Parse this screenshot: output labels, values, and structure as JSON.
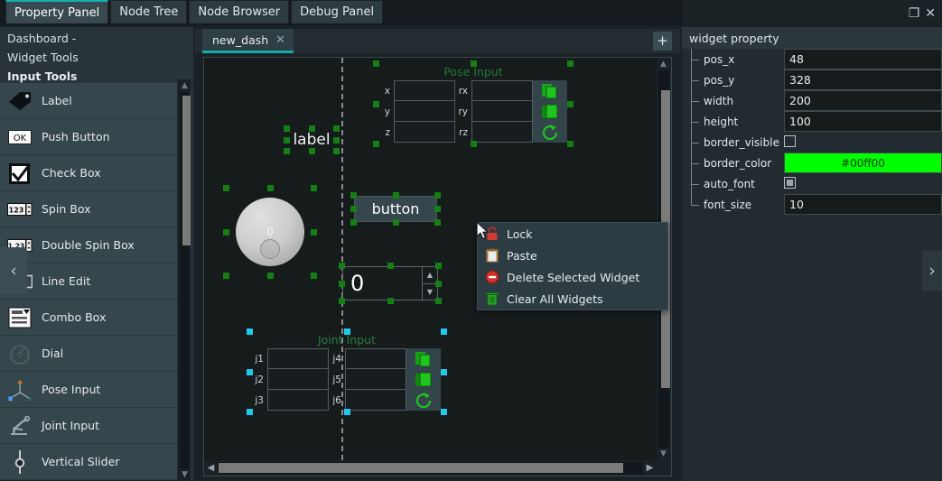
{
  "panel_tabs": [
    {
      "label": "Property Panel",
      "active": true
    },
    {
      "label": "Node Tree",
      "active": false
    },
    {
      "label": "Node Browser",
      "active": false
    },
    {
      "label": "Debug Panel",
      "active": false
    }
  ],
  "left_dock": {
    "title_line1": "Dashboard -",
    "title_line2": "Widget Tools",
    "section_header": "Input Tools",
    "items": [
      {
        "label": "Label",
        "icon": "tag-icon"
      },
      {
        "label": "Push Button",
        "icon": "ok-button-icon"
      },
      {
        "label": "Check Box",
        "icon": "checkbox-icon"
      },
      {
        "label": "Spin Box",
        "icon": "spinbox-123-icon"
      },
      {
        "label": "Double Spin Box",
        "icon": "spinbox-1-23-icon"
      },
      {
        "label": "Line Edit",
        "icon": "line-edit-icon"
      },
      {
        "label": "Combo Box",
        "icon": "combobox-icon"
      },
      {
        "label": "Dial",
        "icon": "dial-icon"
      },
      {
        "label": "Pose Input",
        "icon": "pose-axes-icon"
      },
      {
        "label": "Joint Input",
        "icon": "robot-arm-icon"
      },
      {
        "label": "Vertical Slider",
        "icon": "vertical-slider-icon"
      }
    ],
    "collapse_glyph": "‹"
  },
  "editor": {
    "tab_label": "new_dash",
    "tab_close_glyph": "✕",
    "add_tab_glyph": "+",
    "accent_color": "#16a9ab"
  },
  "canvas": {
    "label_widget": {
      "text": "label"
    },
    "button_widget": {
      "text": "button"
    },
    "dial_widget": {
      "value": "0"
    },
    "spin_widget": {
      "value": "0",
      "up_glyph": "▲",
      "down_glyph": "▼"
    },
    "pose_input": {
      "title": "Pose Input",
      "left_labels": [
        "x",
        "y",
        "z"
      ],
      "right_labels": [
        "rx",
        "ry",
        "rz"
      ],
      "left_values": [
        "",
        "",
        ""
      ],
      "right_values": [
        "",
        "",
        ""
      ],
      "buttons": [
        "copy-icon",
        "paste-icon",
        "reset-icon"
      ],
      "handle_color": "#157f15"
    },
    "joint_input": {
      "title": "Joint Input",
      "left_labels": [
        "j1",
        "j2",
        "j3"
      ],
      "right_labels": [
        "j4",
        "j5",
        "j6"
      ],
      "left_values": [
        "",
        "",
        ""
      ],
      "right_values": [
        "",
        "",
        ""
      ],
      "buttons": [
        "copy-icon",
        "paste-icon",
        "reset-icon"
      ],
      "handle_color": "#22c8ee"
    }
  },
  "context_menu": {
    "items": [
      {
        "label": "Lock",
        "icon": "lock-icon"
      },
      {
        "label": "Paste",
        "icon": "clipboard-icon"
      },
      {
        "label": "Delete Selected Widget",
        "icon": "delete-icon"
      },
      {
        "label": "Clear All Widgets",
        "icon": "trash-icon"
      }
    ]
  },
  "right_dock": {
    "window_buttons": [
      {
        "name": "float-icon",
        "glyph": "❐"
      },
      {
        "name": "close-icon",
        "glyph": "✕"
      }
    ],
    "header": "widget property",
    "properties": [
      {
        "name": "pos_x",
        "type": "text",
        "value": "48"
      },
      {
        "name": "pos_y",
        "type": "text",
        "value": "328"
      },
      {
        "name": "width",
        "type": "text",
        "value": "200"
      },
      {
        "name": "height",
        "type": "text",
        "value": "100"
      },
      {
        "name": "border_visible",
        "type": "checkbox",
        "value": "unchecked"
      },
      {
        "name": "border_color",
        "type": "color",
        "value": "#00ff00"
      },
      {
        "name": "auto_font",
        "type": "checkbox",
        "value": "filled"
      },
      {
        "name": "font_size",
        "type": "text",
        "value": "10"
      }
    ],
    "collapse_glyph": "›"
  }
}
